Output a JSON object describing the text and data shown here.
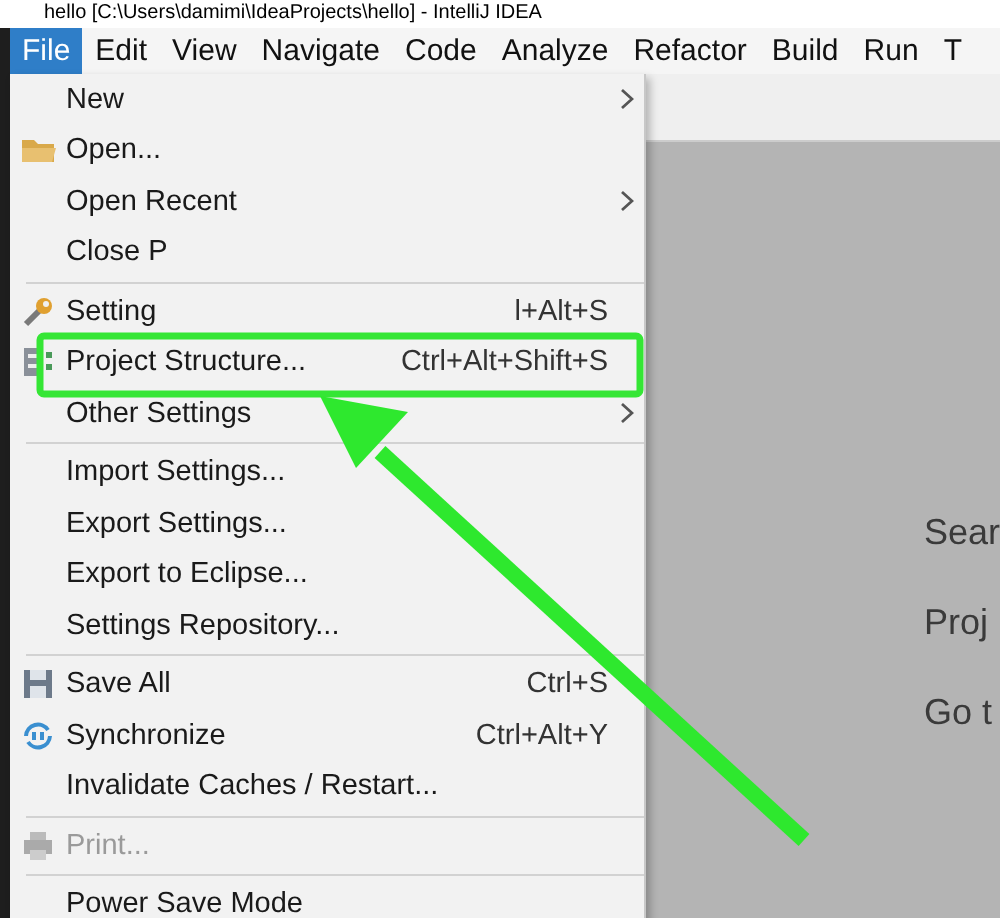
{
  "window": {
    "title": "hello [C:\\Users\\damimi\\IdeaProjects\\hello] - IntelliJ IDEA"
  },
  "menu_bar": [
    {
      "label": "File",
      "selected": true
    },
    {
      "label": "Edit",
      "selected": false
    },
    {
      "label": "View",
      "selected": false
    },
    {
      "label": "Navigate",
      "selected": false
    },
    {
      "label": "Code",
      "selected": false
    },
    {
      "label": "Analyze",
      "selected": false
    },
    {
      "label": "Refactor",
      "selected": false
    },
    {
      "label": "Build",
      "selected": false
    },
    {
      "label": "Run",
      "selected": false
    },
    {
      "label": "T",
      "selected": false
    }
  ],
  "file_menu": [
    {
      "kind": "item",
      "label": "New",
      "submenu": true,
      "disabled": false
    },
    {
      "kind": "item",
      "label": "Open...",
      "submenu": false,
      "disabled": false
    },
    {
      "kind": "item",
      "label": "Open Recent",
      "submenu": true,
      "disabled": false
    },
    {
      "kind": "item",
      "label": "Close P",
      "submenu": false,
      "disabled": false
    },
    {
      "kind": "separator"
    },
    {
      "kind": "item",
      "label": "Setting",
      "shortcut": "l+Alt+S",
      "submenu": false,
      "disabled": false
    },
    {
      "kind": "item",
      "label": "Project Structure...",
      "shortcut": "Ctrl+Alt+Shift+S",
      "submenu": false,
      "disabled": false
    },
    {
      "kind": "item",
      "label": "Other Settings",
      "submenu": true,
      "disabled": false
    },
    {
      "kind": "separator"
    },
    {
      "kind": "item",
      "label": "Import Settings...",
      "submenu": false,
      "disabled": false
    },
    {
      "kind": "item",
      "label": "Export Settings...",
      "submenu": false,
      "disabled": false
    },
    {
      "kind": "item",
      "label": "Export to Eclipse...",
      "submenu": false,
      "disabled": false
    },
    {
      "kind": "item",
      "label": "Settings Repository...",
      "submenu": false,
      "disabled": false
    },
    {
      "kind": "separator"
    },
    {
      "kind": "item",
      "label": "Save All",
      "shortcut": "Ctrl+S",
      "submenu": false,
      "disabled": false
    },
    {
      "kind": "item",
      "label": "Synchronize",
      "shortcut": "Ctrl+Alt+Y",
      "submenu": false,
      "disabled": false
    },
    {
      "kind": "item",
      "label": "Invalidate Caches / Restart...",
      "submenu": false,
      "disabled": false
    },
    {
      "kind": "separator"
    },
    {
      "kind": "item",
      "label": "Print...",
      "submenu": false,
      "disabled": true
    },
    {
      "kind": "separator"
    },
    {
      "kind": "item",
      "label": "Power Save Mode",
      "submenu": false,
      "disabled": false
    }
  ],
  "welcome_hints": [
    "Sear",
    "Proj",
    "Go t"
  ]
}
